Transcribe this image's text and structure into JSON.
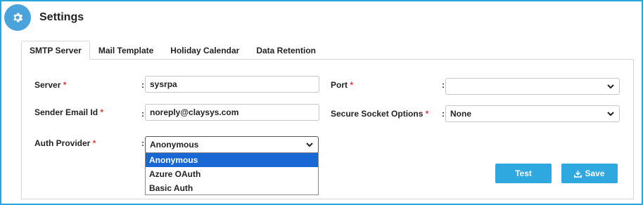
{
  "header": {
    "title": "Settings",
    "icon": "gear-icon",
    "icon_bg": "#4aa3da"
  },
  "tabs": [
    {
      "label": "SMTP Server",
      "active": true
    },
    {
      "label": "Mail Template",
      "active": false
    },
    {
      "label": "Holiday Calendar",
      "active": false
    },
    {
      "label": "Data Retention",
      "active": false
    }
  ],
  "form": {
    "server": {
      "label": "Server",
      "required": "*",
      "value": "sysrpa"
    },
    "port": {
      "label": "Port",
      "required": "*",
      "value": ""
    },
    "sender_email": {
      "label": "Sender Email Id",
      "required": "*",
      "value": "noreply@claysys.com"
    },
    "secure_socket": {
      "label": "Secure Socket Options",
      "required": "*",
      "value": "None"
    },
    "auth_provider": {
      "label": "Auth Provider",
      "required": "*",
      "value": "Anonymous",
      "options": [
        "Anonymous",
        "Azure OAuth",
        "Basic Auth"
      ]
    },
    "colon": ":"
  },
  "buttons": {
    "test": "Test",
    "save": "Save"
  },
  "colors": {
    "accent": "#2ea8df",
    "border": "#29a7dd",
    "required": "#e53935",
    "selected_option": "#1967d2"
  }
}
